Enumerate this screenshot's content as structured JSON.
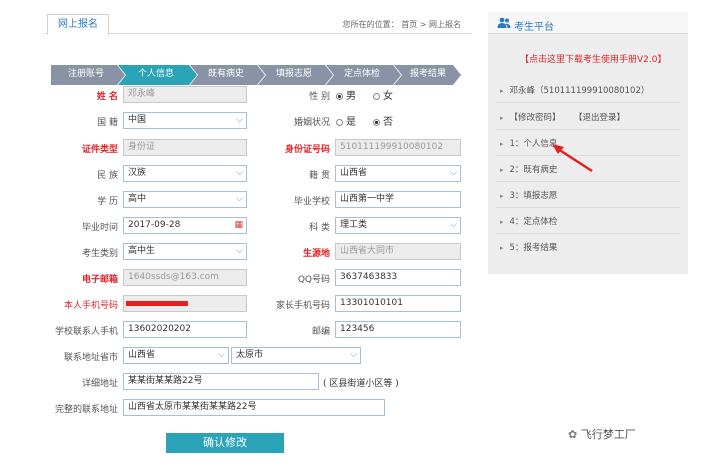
{
  "header": {
    "tab_label": "网上报名",
    "location_text": "您所在的位置： 首页 > 网上报名"
  },
  "steps": [
    "注册账号",
    "个人信息",
    "既有病史",
    "填报志愿",
    "定点体检",
    "报考结果"
  ],
  "active_step_index": 1,
  "colors": {
    "accent": "#2b7cc0",
    "step_active": "#2aa3b8",
    "step_inactive": "#8a93a6",
    "required": "#e0262a"
  },
  "form": {
    "name": {
      "label": "姓 名",
      "value": "邓永峰"
    },
    "gender": {
      "label": "性 别",
      "options": [
        "男",
        "女"
      ],
      "selected": "男"
    },
    "nationality": {
      "label": "国 籍",
      "value": "中国"
    },
    "marital": {
      "label": "婚姻状况",
      "options": [
        "是",
        "否"
      ],
      "selected": "否"
    },
    "id_type": {
      "label": "证件类型",
      "value": "身份证"
    },
    "id_number": {
      "label": "身份证号码",
      "value": "510111199910080102"
    },
    "ethnicity": {
      "label": "民 族",
      "value": "汉族"
    },
    "native_place": {
      "label": "籍 贯",
      "value": "山西省"
    },
    "education": {
      "label": "学 历",
      "value": "高中"
    },
    "school": {
      "label": "毕业学校",
      "value": "山西第一中学"
    },
    "grad_date": {
      "label": "毕业时间",
      "value": "2017-09-28"
    },
    "subject": {
      "label": "科 类",
      "value": "理工类"
    },
    "candidate_type": {
      "label": "考生类别",
      "value": "高中生"
    },
    "origin": {
      "label": "生源地",
      "value": "山西省大同市"
    },
    "email": {
      "label": "电子邮箱",
      "value": "1640ssds@163.com"
    },
    "qq": {
      "label": "QQ号码",
      "value": "3637463833"
    },
    "mobile": {
      "label": "本人手机号码",
      "value": ""
    },
    "parent_phone": {
      "label": "家长手机号码",
      "value": "13301010101"
    },
    "school_contact_phone": {
      "label": "学校联系人手机",
      "value": "13602020202"
    },
    "postcode": {
      "label": "邮编",
      "value": "123456"
    },
    "contact_province_city": {
      "label": "联系地址省市",
      "province": "山西省",
      "city": "太原市"
    },
    "address_detail": {
      "label": "详细地址",
      "value": "某某街某某路22号",
      "hint": "( 区县街道小区等 )"
    },
    "full_address": {
      "label": "完整的联系地址",
      "value": "山西省太原市某某街某某路22号"
    },
    "submit_label": "确认修改"
  },
  "sidebar": {
    "title": "考生平台",
    "manual_link": "【点击这里下载考生使用手册V2.0】",
    "user_line": "邓永峰（510111199910080102）",
    "account_links": [
      "【修改密码】",
      "【退出登录】"
    ],
    "nav_items": [
      "1：个人信息",
      "2：既有病史",
      "3：填报志愿",
      "4：定点体检",
      "5：报考结果"
    ]
  },
  "watermark": "飞行梦工厂"
}
